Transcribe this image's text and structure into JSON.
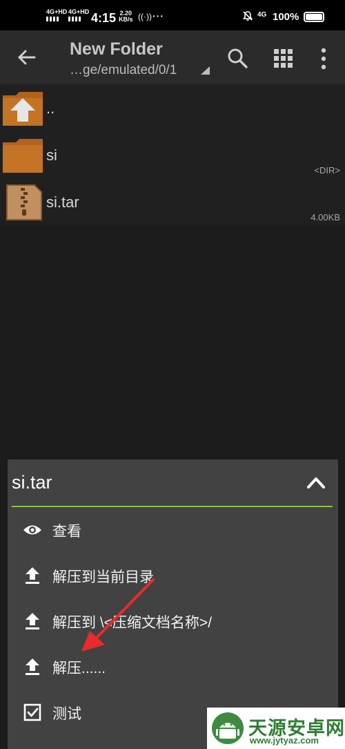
{
  "status_bar": {
    "net1": "4G+HD",
    "net2": "4G+HD",
    "time": "4:15",
    "speed_value": "2.20",
    "speed_unit": "KB/s",
    "dots": "···",
    "net_right": "4G",
    "battery_text": "100%"
  },
  "toolbar": {
    "title": "New Folder",
    "path": "…ge/emulated/0/1",
    "back_icon": "arrow-left-icon",
    "search_icon": "search-icon",
    "grid_icon": "grid-view-icon",
    "more_icon": "more-vert-icon"
  },
  "files": [
    {
      "name": "..",
      "meta": "",
      "icon": "folder-up-icon"
    },
    {
      "name": "si",
      "meta": "<DIR>",
      "icon": "folder-icon"
    },
    {
      "name": "si.tar",
      "meta": "4.00KB",
      "icon": "archive-file-icon"
    }
  ],
  "sheet": {
    "title": "si.tar",
    "accent": "#8bc34a",
    "items": [
      {
        "label": "查看",
        "icon": "eye-icon"
      },
      {
        "label": "解压到当前目录",
        "icon": "extract-icon"
      },
      {
        "label": "解压到 \\<压缩文档名称>/",
        "icon": "extract-icon"
      },
      {
        "label": "解压......",
        "icon": "extract-icon"
      },
      {
        "label": "测试",
        "icon": "checkbox-icon"
      }
    ]
  },
  "watermark": {
    "text": "天源安卓网",
    "url": "www.jytyaz.com"
  },
  "colors": {
    "background": "#1c1c1c",
    "toolbar": "#2b2b2b",
    "sheet": "#424242",
    "folder": "#b0641e",
    "annotation": "#e82b2b"
  }
}
